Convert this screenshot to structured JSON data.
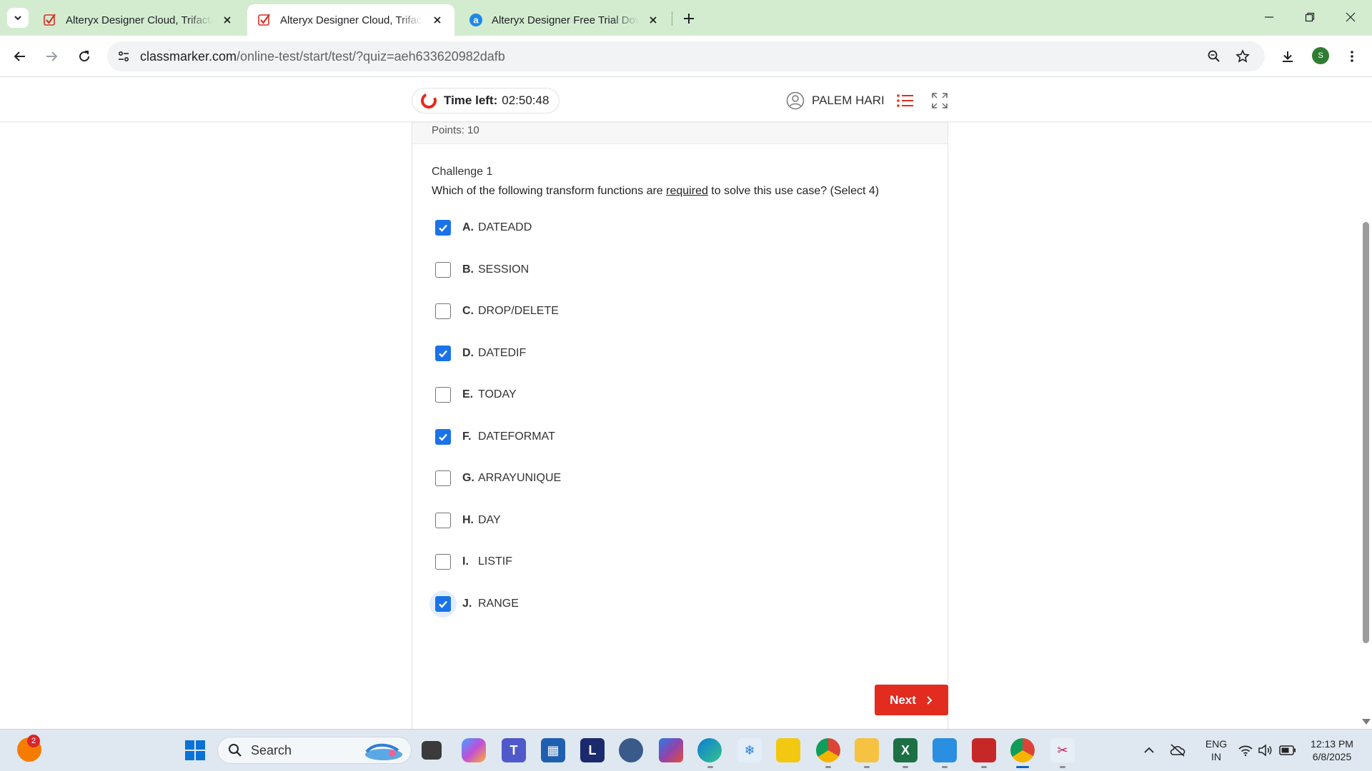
{
  "browser": {
    "tabs": [
      {
        "title": "Alteryx Designer Cloud, Trifacta",
        "icon": "classmarker-check-icon",
        "active": false
      },
      {
        "title": "Alteryx Designer Cloud, Trifacta",
        "icon": "classmarker-check-icon",
        "active": true
      },
      {
        "title": "Alteryx Designer Free Trial Down",
        "icon": "alteryx-a-icon",
        "active": false
      }
    ],
    "url_host": "classmarker.com",
    "url_path": "/online-test/start/test/?quiz=aeh633620982dafb",
    "profile_initial": "S",
    "accent": "#d3ecd0"
  },
  "header": {
    "timer_label": "Time left:",
    "timer_value": "02:50:48",
    "user_name": "PALEM HARI"
  },
  "question": {
    "points_label": "Points: 10",
    "title": "Challenge 1",
    "text_before": "Which of the following transform functions are ",
    "text_underlined": "required",
    "text_after": " to solve this use case? (Select 4)",
    "options": [
      {
        "letter": "A.",
        "text": "DATEADD",
        "checked": true
      },
      {
        "letter": "B.",
        "text": "SESSION",
        "checked": false
      },
      {
        "letter": "C.",
        "text": "DROP/DELETE",
        "checked": false
      },
      {
        "letter": "D.",
        "text": "DATEDIF",
        "checked": true
      },
      {
        "letter": "E.",
        "text": "TODAY",
        "checked": false
      },
      {
        "letter": "F.",
        "text": "DATEFORMAT",
        "checked": true
      },
      {
        "letter": "G.",
        "text": "ARRAYUNIQUE",
        "checked": false
      },
      {
        "letter": "H.",
        "text": "DAY",
        "checked": false
      },
      {
        "letter": "I.",
        "text": "LISTIF",
        "checked": false
      },
      {
        "letter": "J.",
        "text": "RANGE",
        "checked": true
      }
    ],
    "next_label": "Next",
    "checkbox_color": "#1a73e8",
    "next_color": "#e12c1f"
  },
  "taskbar": {
    "search_placeholder": "Search",
    "notification_count": "2",
    "lang_top": "ENG",
    "lang_bottom": "IN",
    "time": "12:13 PM",
    "date": "6/8/2025"
  }
}
